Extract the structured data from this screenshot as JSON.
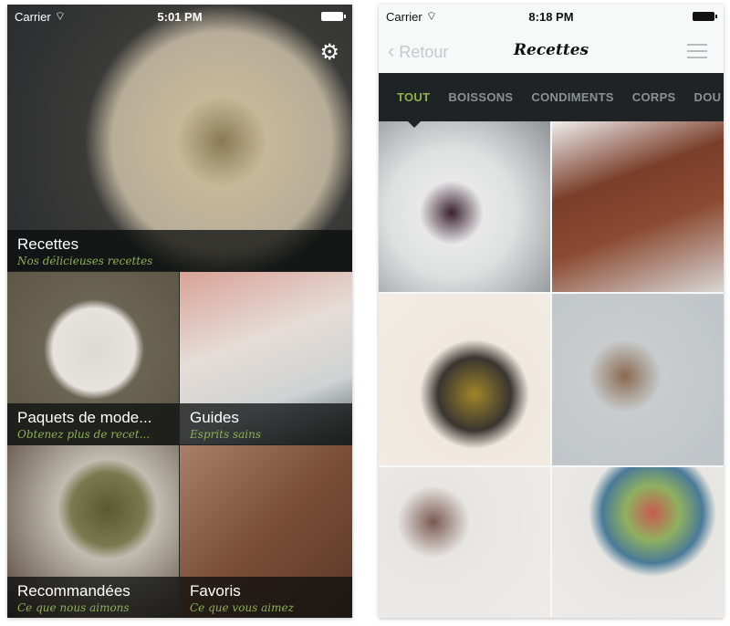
{
  "left_screen": {
    "status": {
      "carrier": "Carrier",
      "time": "5:01 PM"
    },
    "settings_icon": "gear-icon",
    "hero": {
      "title": "Recettes",
      "subtitle": "Nos délicieuses recettes"
    },
    "tiles": [
      {
        "title": "Paquets de mode...",
        "subtitle": "Obtenez plus de recet..."
      },
      {
        "title": "Guides",
        "subtitle": "Esprits sains"
      },
      {
        "title": "Recommandées",
        "subtitle": "Ce que nous aimons"
      },
      {
        "title": "Favoris",
        "subtitle": "Ce que vous aimez"
      }
    ]
  },
  "right_screen": {
    "status": {
      "carrier": "Carrier",
      "time": "8:18 PM"
    },
    "nav": {
      "back": "Retour",
      "title": "Recettes",
      "menu_icon": "hamburger-icon"
    },
    "categories": [
      "TOUT",
      "BOISSONS",
      "CONDIMENTS",
      "CORPS",
      "DOU"
    ],
    "active_category": "TOUT"
  },
  "colors": {
    "accent": "#8fb04a",
    "category_bar": "#1f2325",
    "caption_subtitle": "#8fae5a"
  }
}
